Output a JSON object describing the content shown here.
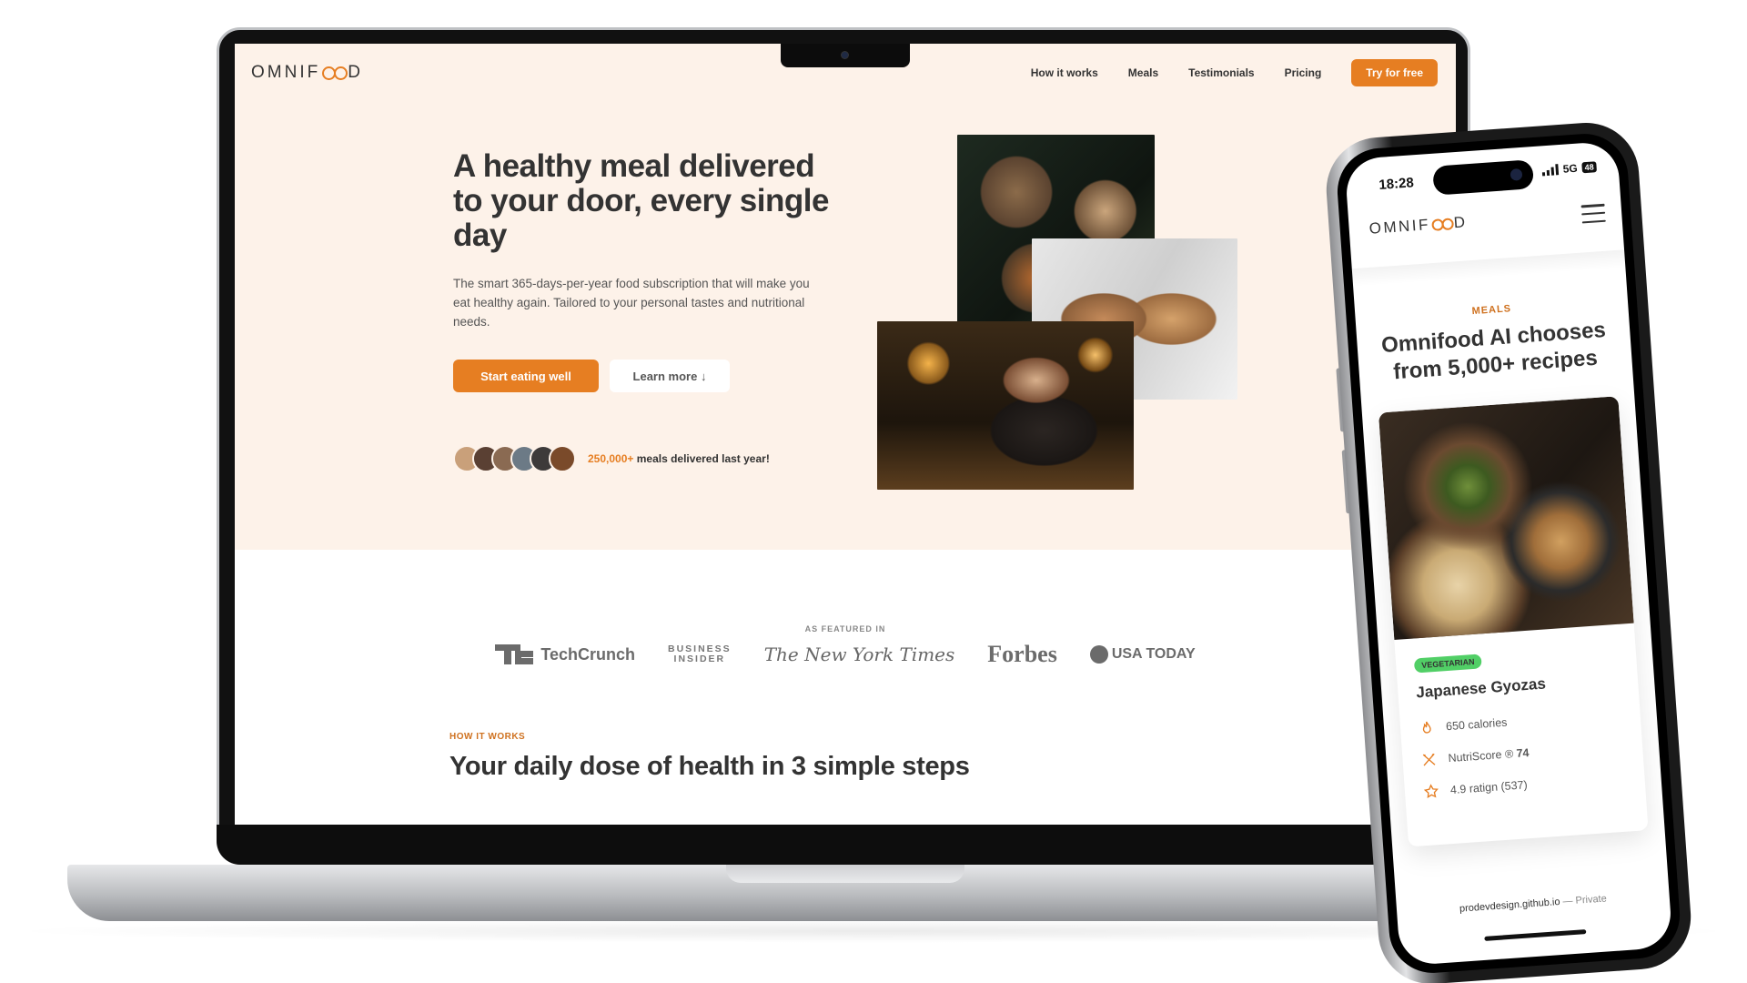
{
  "site": {
    "logo": "OMNIFOOD",
    "logo_parts": {
      "before": "OMNIF",
      "after": "D"
    },
    "nav": [
      {
        "label": "How it works"
      },
      {
        "label": "Meals"
      },
      {
        "label": "Testimonials"
      },
      {
        "label": "Pricing"
      }
    ],
    "cta": "Try for free",
    "hero": {
      "title": "A healthy meal delivered to your door, every single day",
      "description": "The smart 365-days-per-year food subscription that will make you eat healthy again. Tailored to your personal tastes and nutritional needs.",
      "primary_button": "Start eating well",
      "secondary_button": "Learn more ↓",
      "delivered_highlight": "250,000+",
      "delivered_rest": "meals delivered last year!"
    },
    "featured": {
      "label": "AS FEATURED IN",
      "logos": {
        "techcrunch": "TechCrunch",
        "business_insider_1": "BUSINESS",
        "business_insider_2": "INSIDER",
        "nyt": "The New York Times",
        "forbes": "Forbes",
        "usatoday": "USA TODAY"
      }
    },
    "how": {
      "label": "HOW IT WORKS",
      "title": "Your daily dose of health in 3 simple steps"
    },
    "colors": {
      "accent": "#e67e22",
      "hero_bg": "#fdf2e9",
      "tag_green": "#51cf66"
    }
  },
  "phone": {
    "status": {
      "time": "18:28",
      "network": "5G",
      "battery": "48"
    },
    "logo_parts": {
      "before": "OMNIF",
      "after": "D"
    },
    "meals_label": "MEALS",
    "meals_title": "Omnifood AI chooses from 5,000+ recipes",
    "card": {
      "tag": "VEGETARIAN",
      "name": "Japanese Gyozas",
      "calories": "650 calories",
      "nutriscore_label": "NutriScore ®",
      "nutriscore_value": "74",
      "rating_text": "4.9 ratign",
      "rating_count": "(537)"
    },
    "url": "prodevdesign.github.io",
    "url_suffix": "— Private"
  },
  "icons": {
    "menu": "hamburger-menu-icon",
    "calories": "flame-icon",
    "nutriscore": "utensils-icon",
    "rating": "star-icon"
  }
}
